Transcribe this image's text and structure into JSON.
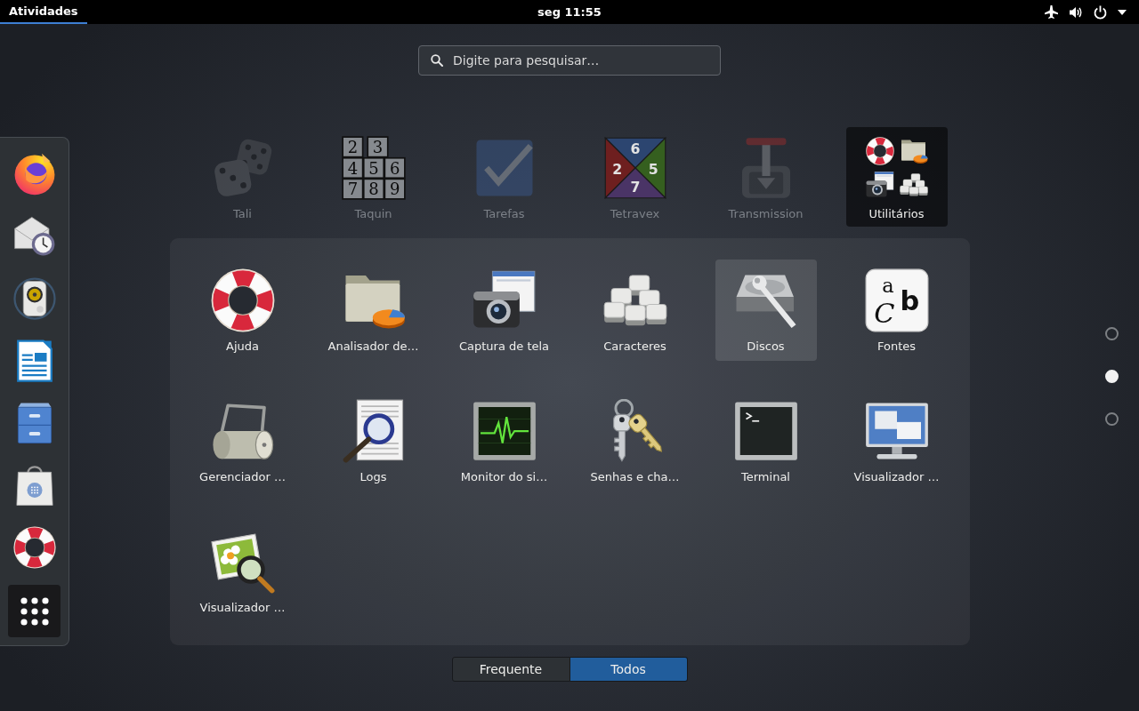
{
  "top_bar": {
    "activities": {
      "label": "Atividades",
      "selected": true
    },
    "clock": "seg 11:55"
  },
  "search": {
    "placeholder": "Digite para pesquisar…"
  },
  "dock": {
    "show_apps": {
      "selected": true
    }
  },
  "app_row": [
    {
      "label": "Tali",
      "kind": "app",
      "selected": false
    },
    {
      "label": "Taquin",
      "kind": "app",
      "selected": false,
      "glyphs": [
        "2",
        "3",
        "4",
        "5",
        "6",
        "7",
        "8",
        "9"
      ]
    },
    {
      "label": "Tarefas",
      "kind": "app",
      "selected": false
    },
    {
      "label": "Tetravex",
      "kind": "app",
      "selected": false,
      "glyphs": [
        "6",
        "2",
        "5",
        "7"
      ]
    },
    {
      "label": "Transmission",
      "kind": "app",
      "selected": false
    },
    {
      "label": "Utilitários",
      "kind": "folder",
      "selected": true
    }
  ],
  "folder": {
    "apps": [
      {
        "label": "Ajuda",
        "selected": false
      },
      {
        "label": "Analisador de…",
        "selected": false
      },
      {
        "label": "Captura de tela",
        "selected": false
      },
      {
        "label": "Caracteres",
        "selected": false
      },
      {
        "label": "Discos",
        "selected": true
      },
      {
        "label": "Fontes",
        "selected": false,
        "glyphs": [
          "a",
          "C",
          "b"
        ]
      },
      {
        "label": "Gerenciador …",
        "selected": false
      },
      {
        "label": "Logs",
        "selected": false
      },
      {
        "label": "Monitor do si…",
        "selected": false
      },
      {
        "label": "Senhas e cha…",
        "selected": false
      },
      {
        "label": "Terminal",
        "selected": false
      },
      {
        "label": "Visualizador …",
        "selected": false
      },
      {
        "label": "Visualizador …",
        "selected": false
      }
    ]
  },
  "view_tabs": [
    {
      "label": "Frequente",
      "selected": false
    },
    {
      "label": "Todos",
      "selected": true
    }
  ],
  "pages": [
    {
      "selected": false
    },
    {
      "selected": true
    },
    {
      "selected": false
    }
  ]
}
